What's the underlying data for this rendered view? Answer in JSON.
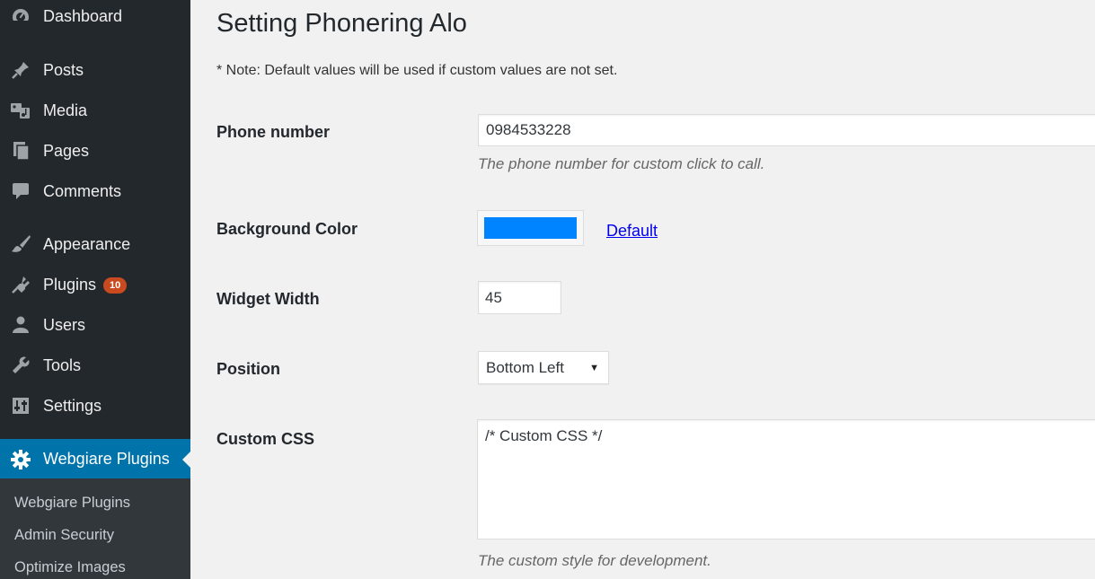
{
  "sidebar": {
    "items": [
      {
        "label": "Dashboard",
        "icon": "dashboard-icon"
      },
      {
        "label": "Posts",
        "icon": "pin-icon"
      },
      {
        "label": "Media",
        "icon": "media-icon"
      },
      {
        "label": "Pages",
        "icon": "pages-icon"
      },
      {
        "label": "Comments",
        "icon": "comment-icon"
      },
      {
        "label": "Appearance",
        "icon": "brush-icon"
      },
      {
        "label": "Plugins",
        "icon": "plugin-icon",
        "badge": "10"
      },
      {
        "label": "Users",
        "icon": "user-icon"
      },
      {
        "label": "Tools",
        "icon": "wrench-icon"
      },
      {
        "label": "Settings",
        "icon": "settings-sliders-icon"
      },
      {
        "label": "Webgiare Plugins",
        "icon": "gear-icon",
        "active": true
      }
    ],
    "submenu": [
      "Webgiare Plugins",
      "Admin Security",
      "Optimize Images"
    ]
  },
  "page": {
    "title": "Setting Phonering Alo",
    "note": "* Note: Default values will be used if custom values are not set."
  },
  "fields": {
    "phone": {
      "label": "Phone number",
      "value": "0984533228",
      "description": "The phone number for custom click to call."
    },
    "bg_color": {
      "label": "Background Color",
      "value": "#0084ff",
      "default_link": "Default"
    },
    "width": {
      "label": "Widget Width",
      "value": "45"
    },
    "position": {
      "label": "Position",
      "selected": "Bottom Left"
    },
    "custom_css": {
      "label": "Custom CSS",
      "value": "/* Custom CSS */",
      "description": "The custom style for development."
    }
  },
  "colors": {
    "sidebar_bg": "#23282d",
    "active_bg": "#0073aa",
    "badge_bg": "#ca4a1f"
  }
}
